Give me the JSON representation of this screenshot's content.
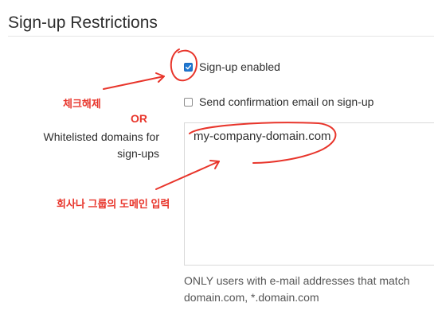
{
  "section": {
    "title": "Sign-up Restrictions"
  },
  "signup_enabled": {
    "label": "Sign-up enabled",
    "checked": true
  },
  "send_confirmation": {
    "label": "Send confirmation email on sign-up",
    "checked": false
  },
  "whitelist": {
    "label_line1": "Whitelisted domains for",
    "label_line2": "sign-ups",
    "value": "my-company-domain.com",
    "help_line1": "ONLY users with e-mail addresses that match",
    "help_line2": "domain.com, *.domain.com"
  },
  "annotations": {
    "uncheck": "체크해제",
    "or": "OR",
    "enter_domain": "회사나 그룹의 도메인 입력",
    "color": "#e8352b"
  },
  "colors": {
    "accent": "#1f78d1",
    "text": "#2e2e2e",
    "muted": "#555555"
  }
}
